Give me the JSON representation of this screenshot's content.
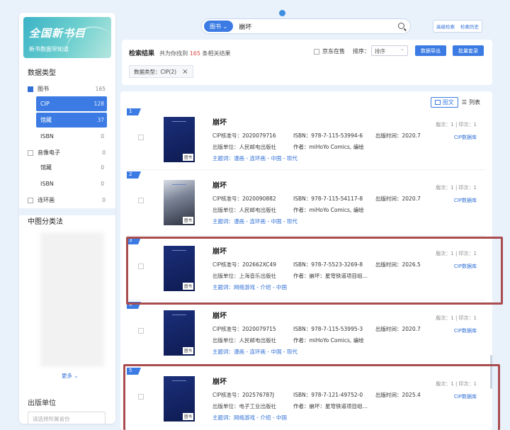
{
  "sidebar": {
    "logo_title": "全国新书目",
    "logo_subtitle": "新书数据早知道",
    "data_type_title": "数据类型",
    "data_types": [
      {
        "label": "图书",
        "count": "165",
        "checked": true,
        "sub": false,
        "active": false
      },
      {
        "label": "CIP",
        "count": "128",
        "checked": false,
        "sub": true,
        "active": true
      },
      {
        "label": "馆藏",
        "count": "37",
        "checked": false,
        "sub": true,
        "active": true
      },
      {
        "label": "ISBN",
        "count": "0",
        "checked": false,
        "sub": true,
        "active": false
      },
      {
        "label": "音像电子",
        "count": "0",
        "checked": false,
        "sub": false,
        "active": false
      },
      {
        "label": "馆藏",
        "count": "0",
        "checked": false,
        "sub": true,
        "active": false
      },
      {
        "label": "ISBN",
        "count": "0",
        "checked": false,
        "sub": true,
        "active": false
      },
      {
        "label": "连环画",
        "count": "0",
        "checked": false,
        "sub": false,
        "active": false
      }
    ],
    "classification_title": "中图分类法",
    "more_label": "更多",
    "publisher_title": "出版单位",
    "publisher_placeholder": "请选择所属省份"
  },
  "search": {
    "category": "图书",
    "query": "崩坏"
  },
  "top_buttons": {
    "advanced": "高级检索",
    "history": "检索历史"
  },
  "results_header": {
    "title": "检索结果",
    "summary_prefix": "共为你找到",
    "count": "165",
    "summary_suffix": "条相关结果",
    "jd_label": "京东在售",
    "sort_label": "排序：",
    "sort_value": "排序",
    "export_button": "数据导出",
    "subscribe_button": "批量套录",
    "filter_tag": "数据类型：CIP(2)"
  },
  "view_toggle": {
    "grid_label": "图文",
    "list_label": "列表"
  },
  "labels": {
    "cip_no": "CIP核准号：",
    "isbn": "ISBN：",
    "pub_date": "出版时间：",
    "publisher": "出版单位：",
    "author": "作者：",
    "keywords": "主题词：",
    "cover_badge": "图书",
    "cip_db": "CIP数据库"
  },
  "results": [
    {
      "num": "1",
      "title": "崩坏",
      "cip": "2020079716",
      "isbn": "978-7-115-53994-6",
      "date": "2020.7",
      "publisher": "人民邮电出版社",
      "author": "miHoYo Comics, 编绘",
      "keywords": "漫画 - 连环画 - 中国 - 现代",
      "edition": "版次：1  |  印次：1",
      "art": false
    },
    {
      "num": "2",
      "title": "崩坏",
      "cip": "2020090882",
      "isbn": "978-7-115-54117-8",
      "date": "2020.7",
      "publisher": "人民邮电出版社",
      "author": "miHoYo Comics, 编绘",
      "keywords": "漫画 - 连环画 - 中国 - 现代",
      "edition": "版次：1  |  印次：1",
      "art": true
    },
    {
      "num": "3",
      "title": "崩坏",
      "cip": "202662XC49",
      "isbn": "978-7-5523-3269-8",
      "date": "2026.5",
      "publisher": "上海音乐出版社",
      "author": "崩坏：星穹铁道项目组…",
      "keywords": "网络游戏 - 介绍 - 中国",
      "edition": "版次：1  |  印次：1",
      "art": false
    },
    {
      "num": "4",
      "title": "崩坏",
      "cip": "2020079715",
      "isbn": "978-7-115-53995-3",
      "date": "2020.7",
      "publisher": "人民邮电出版社",
      "author": "miHoYo Comics, 编绘",
      "keywords": "漫画 - 连环画 - 中国 - 现代",
      "edition": "版次：1  |  印次：1",
      "art": false
    },
    {
      "num": "5",
      "title": "崩坏",
      "cip": "202576787J",
      "isbn": "978-7-121-49752-0",
      "date": "2025.4",
      "publisher": "电子工业出版社",
      "author": "崩坏：星穹铁道项目组…",
      "keywords": "网络游戏 - 介绍 - 中国",
      "edition": "版次：1  |  印次：1",
      "art": false
    }
  ],
  "colors": {
    "accent": "#3b7be3",
    "highlight_box": "#a94c4f",
    "count_red": "#e04545"
  }
}
